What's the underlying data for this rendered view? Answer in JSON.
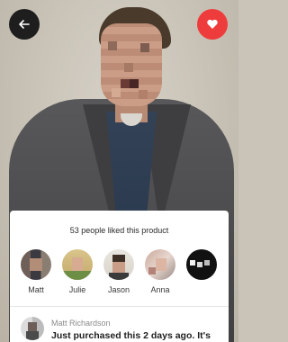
{
  "top_bar": {
    "back_icon": "arrow-left-icon",
    "favorite_icon": "heart-icon",
    "favorite_color": "#ee3b3b",
    "back_color": "#1e1e1e"
  },
  "likes": {
    "summary": "53 people liked this product",
    "users": [
      {
        "name": "Matt"
      },
      {
        "name": "Julie"
      },
      {
        "name": "Jason"
      },
      {
        "name": "Anna"
      }
    ],
    "more_icon": "more-users-icon"
  },
  "comment": {
    "author": "Matt Richardson",
    "text": "Just purchased this 2 days ago. It's"
  }
}
